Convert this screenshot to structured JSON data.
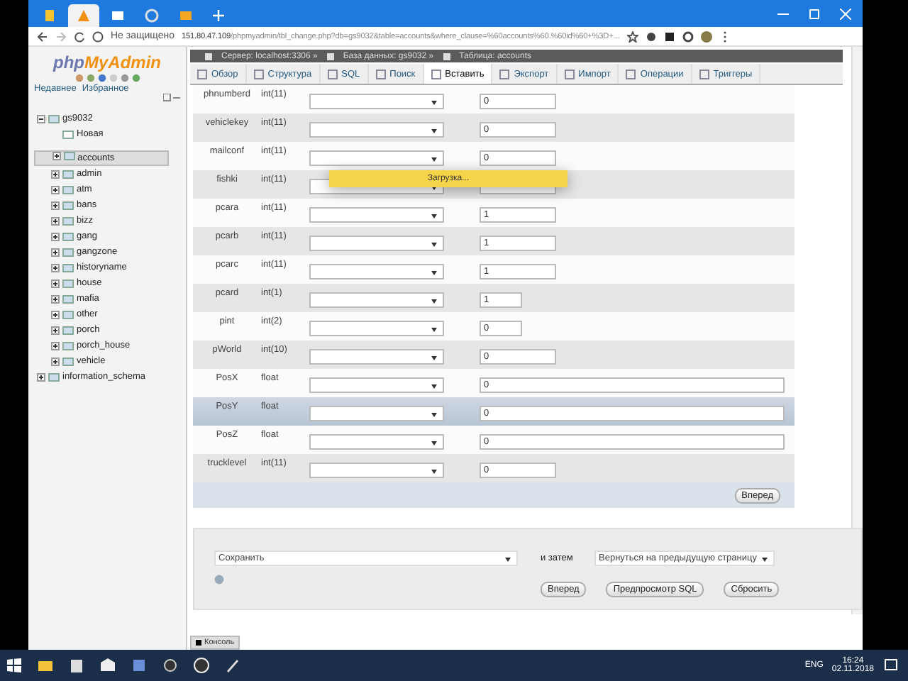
{
  "browser": {
    "tabs": [
      {
        "kind": "doc",
        "selected": false
      },
      {
        "kind": "pma",
        "selected": true
      },
      {
        "kind": "chat",
        "selected": false
      },
      {
        "kind": "globe",
        "selected": false
      },
      {
        "kind": "mail",
        "selected": false
      }
    ],
    "security": "Не защищено",
    "url_host": "151.80.47.109",
    "url_path": "/phpmyadmin/tbl_change.php?db=gs9032&table=accounts&where_clause=%60accounts%60.%60id%60+%3D+..."
  },
  "sidebar": {
    "logo_prefix": "php",
    "logo_name": "MyAdmin",
    "links": [
      "Недавнее",
      "Избранное"
    ],
    "tree": [
      {
        "label": "gs9032",
        "expanded": true,
        "selected": false,
        "children": [
          {
            "label": "Новая",
            "kind": "new",
            "selected": false
          },
          {
            "label": "accounts",
            "kind": "table",
            "selected": true
          },
          {
            "label": "admin",
            "kind": "table",
            "selected": false
          },
          {
            "label": "atm",
            "kind": "table",
            "selected": false
          },
          {
            "label": "bans",
            "kind": "table",
            "selected": false
          },
          {
            "label": "bizz",
            "kind": "table",
            "selected": false
          },
          {
            "label": "gang",
            "kind": "table",
            "selected": false
          },
          {
            "label": "gangzone",
            "kind": "table",
            "selected": false
          },
          {
            "label": "historyname",
            "kind": "table",
            "selected": false
          },
          {
            "label": "house",
            "kind": "table",
            "selected": false
          },
          {
            "label": "mafia",
            "kind": "table",
            "selected": false
          },
          {
            "label": "other",
            "kind": "table",
            "selected": false
          },
          {
            "label": "porch",
            "kind": "table",
            "selected": false
          },
          {
            "label": "porch_house",
            "kind": "table",
            "selected": false
          },
          {
            "label": "vehicle",
            "kind": "table",
            "selected": false
          }
        ]
      },
      {
        "label": "information_schema",
        "expanded": false,
        "selected": false
      }
    ]
  },
  "breadcrumb": [
    "Сервер: localhost:3306 »",
    "База данных: gs9032 »",
    "Таблица: accounts"
  ],
  "tabs": [
    {
      "label": "Обзор",
      "selected": false
    },
    {
      "label": "Структура",
      "selected": false
    },
    {
      "label": "SQL",
      "selected": false
    },
    {
      "label": "Поиск",
      "selected": false
    },
    {
      "label": "Вставить",
      "selected": true
    },
    {
      "label": "Экспорт",
      "selected": false
    },
    {
      "label": "Импорт",
      "selected": false
    },
    {
      "label": "Операции",
      "selected": false
    },
    {
      "label": "Триггеры",
      "selected": false
    }
  ],
  "rows": [
    {
      "name": "phnumberd",
      "type": "int(11)",
      "value": "0",
      "kind": "medium",
      "highlighted": false
    },
    {
      "name": "vehiclekey",
      "type": "int(11)",
      "value": "0",
      "kind": "medium",
      "highlighted": false
    },
    {
      "name": "mailconf",
      "type": "int(11)",
      "value": "0",
      "kind": "medium",
      "highlighted": false
    },
    {
      "name": "fishki",
      "type": "int(11)",
      "kind": "medium",
      "highlighted": false
    },
    {
      "name": "pcara",
      "type": "int(11)",
      "value": "1",
      "kind": "medium",
      "highlighted": false
    },
    {
      "name": "pcarb",
      "type": "int(11)",
      "value": "1",
      "kind": "medium",
      "highlighted": false
    },
    {
      "name": "pcarc",
      "type": "int(11)",
      "value": "1",
      "kind": "medium",
      "highlighted": false
    },
    {
      "name": "pcard",
      "type": "int(1)",
      "value": "1",
      "kind": "small",
      "highlighted": false
    },
    {
      "name": "pint",
      "type": "int(2)",
      "value": "0",
      "kind": "small",
      "highlighted": false
    },
    {
      "name": "pWorld",
      "type": "int(10)",
      "value": "0",
      "kind": "medium",
      "highlighted": false
    },
    {
      "name": "PosX",
      "type": "float",
      "value": "0",
      "kind": "large",
      "highlighted": false
    },
    {
      "name": "PosY",
      "type": "float",
      "value": "0",
      "kind": "large",
      "highlighted": true
    },
    {
      "name": "PosZ",
      "type": "float",
      "value": "0",
      "kind": "large",
      "highlighted": false
    },
    {
      "name": "trucklevel",
      "type": "int(11)",
      "value": "0",
      "kind": "medium",
      "highlighted": false
    }
  ],
  "next_button": "Вперед",
  "loading": "Загрузка...",
  "form": {
    "action": "Сохранить",
    "then_label": "и затем",
    "after": "Вернуться на предыдущую страницу",
    "buttons": [
      "Вперед",
      "Предпросмотр SQL",
      "Сбросить"
    ]
  },
  "console": "Консоль",
  "taskbar": {
    "apps": [
      {
        "kind": "explorer"
      },
      {
        "kind": "store"
      },
      {
        "kind": "mail"
      },
      {
        "kind": "window"
      },
      {
        "kind": "media"
      },
      {
        "kind": "chrome"
      },
      {
        "kind": "pen"
      }
    ],
    "language": "ENG",
    "time": "16:24",
    "date": "02.11.2018"
  }
}
